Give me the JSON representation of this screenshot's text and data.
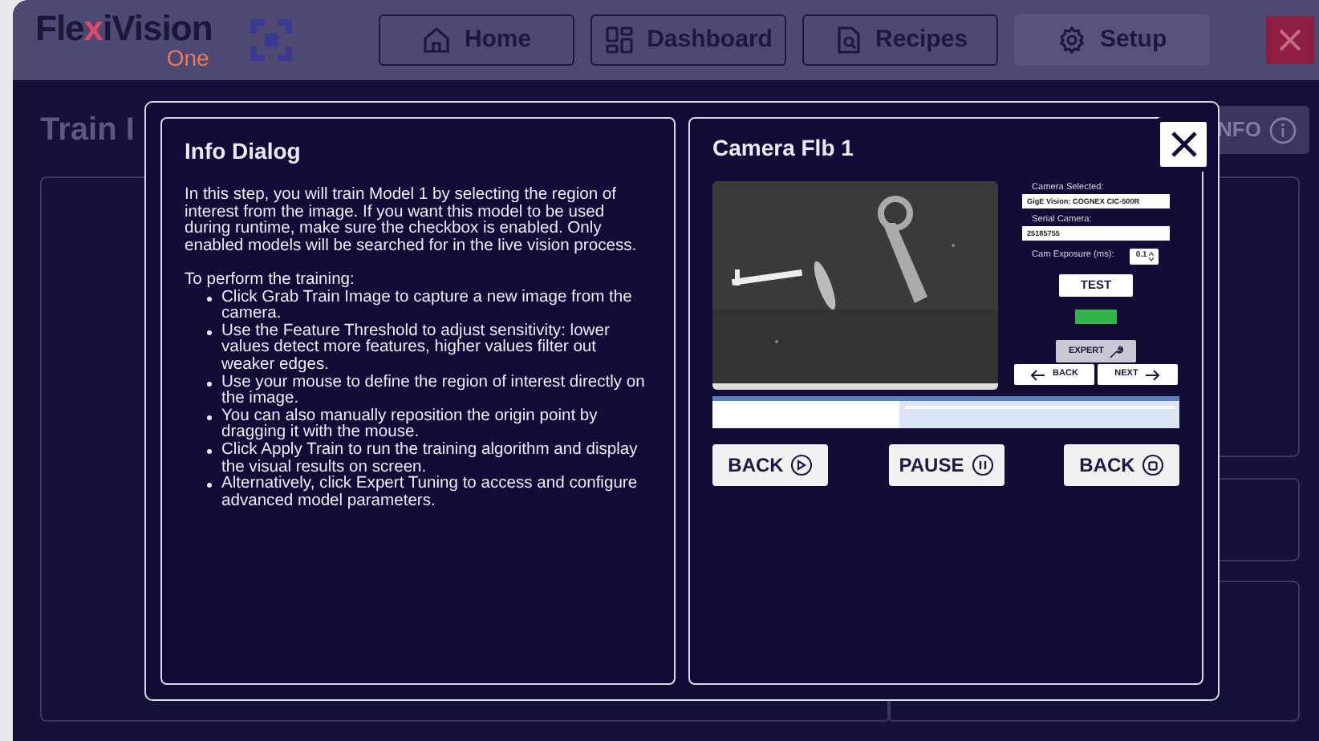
{
  "header": {
    "logo": {
      "part_1": "Fle",
      "part_2": "x",
      "part_3": "iVision",
      "sub": "One"
    },
    "nav": [
      {
        "label": "Home",
        "kind": "home",
        "selected": false
      },
      {
        "label": "Dashboard",
        "kind": "dashboard",
        "selected": false
      },
      {
        "label": "Recipes",
        "kind": "recipes",
        "selected": false
      },
      {
        "label": "Setup",
        "kind": "setup",
        "selected": true
      }
    ]
  },
  "page": {
    "title": "Train I",
    "info_button": "NFO"
  },
  "info_dialog": {
    "title": "Info Dialog",
    "intro": "In this step, you will train Model 1 by selecting the region of interest from the image. If you want this model to be used during runtime, make sure the checkbox is enabled. Only enabled models will be searched for in the live vision process.",
    "steps_heading": "To perform the training:",
    "steps": [
      "Click Grab Train Image to capture a new image from the camera.",
      "Use the Feature Threshold to adjust sensitivity: lower values detect more features, higher values filter out weaker edges.",
      "Use your mouse to define the region of interest directly on the image.",
      "You can also manually reposition the origin point by dragging it with the mouse.",
      "Click Apply Train to run the training algorithm and display the visual results on screen.",
      "Alternatively, click Expert Tuning to access and configure advanced model parameters."
    ]
  },
  "camera_panel": {
    "title": "Camera Flb 1",
    "fields": [
      {
        "label": "Camera Selected:",
        "value": "GigE Vision: COGNEX CIC-500R"
      },
      {
        "label": "Serial Camera:",
        "value": "25185755"
      }
    ],
    "exposure": {
      "label": "Cam Exposure (ms):",
      "value": "0.1"
    },
    "test_button": "TEST",
    "status": {
      "color": "#2fb54a"
    },
    "expert_button": "EXPERT",
    "step_buttons": [
      {
        "label": "BACK",
        "kind": "back"
      },
      {
        "label": "NEXT",
        "kind": "next"
      }
    ],
    "actions": [
      {
        "label": "BACK",
        "kind": "play"
      },
      {
        "label": "PAUSE",
        "kind": "pause"
      },
      {
        "label": "BACK",
        "kind": "stop"
      }
    ]
  }
}
